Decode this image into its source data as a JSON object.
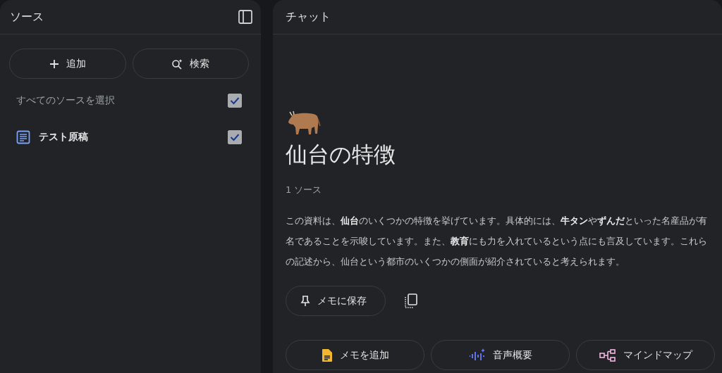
{
  "sources_panel": {
    "title": "ソース",
    "buttons": [
      {
        "kind": "add",
        "label": "追加"
      },
      {
        "kind": "search",
        "label": "検索"
      }
    ],
    "select_all": {
      "label": "すべてのソースを選択",
      "checked": true
    },
    "items": [
      {
        "label": "テスト原稿",
        "checked": true
      }
    ]
  },
  "chat_panel": {
    "title": "チャット",
    "heading": "仙台の特徴",
    "source_count": "1 ソース",
    "summary": "この資料は、**仙台**のいくつかの特徴を挙げています。具体的には、**牛タン**や**ずんだ**といった名産品が有名であることを示唆しています。また、**教育**にも力を入れているという点にも言及しています。これらの記述から、仙台という都市のいくつかの側面が紹介されていると考えられます。",
    "save_button": "メモに保存",
    "actions": [
      {
        "kind": "note",
        "label": "メモを追加"
      },
      {
        "kind": "audio",
        "label": "音声概要"
      },
      {
        "kind": "mindmap",
        "label": "マインドマップ"
      }
    ]
  }
}
